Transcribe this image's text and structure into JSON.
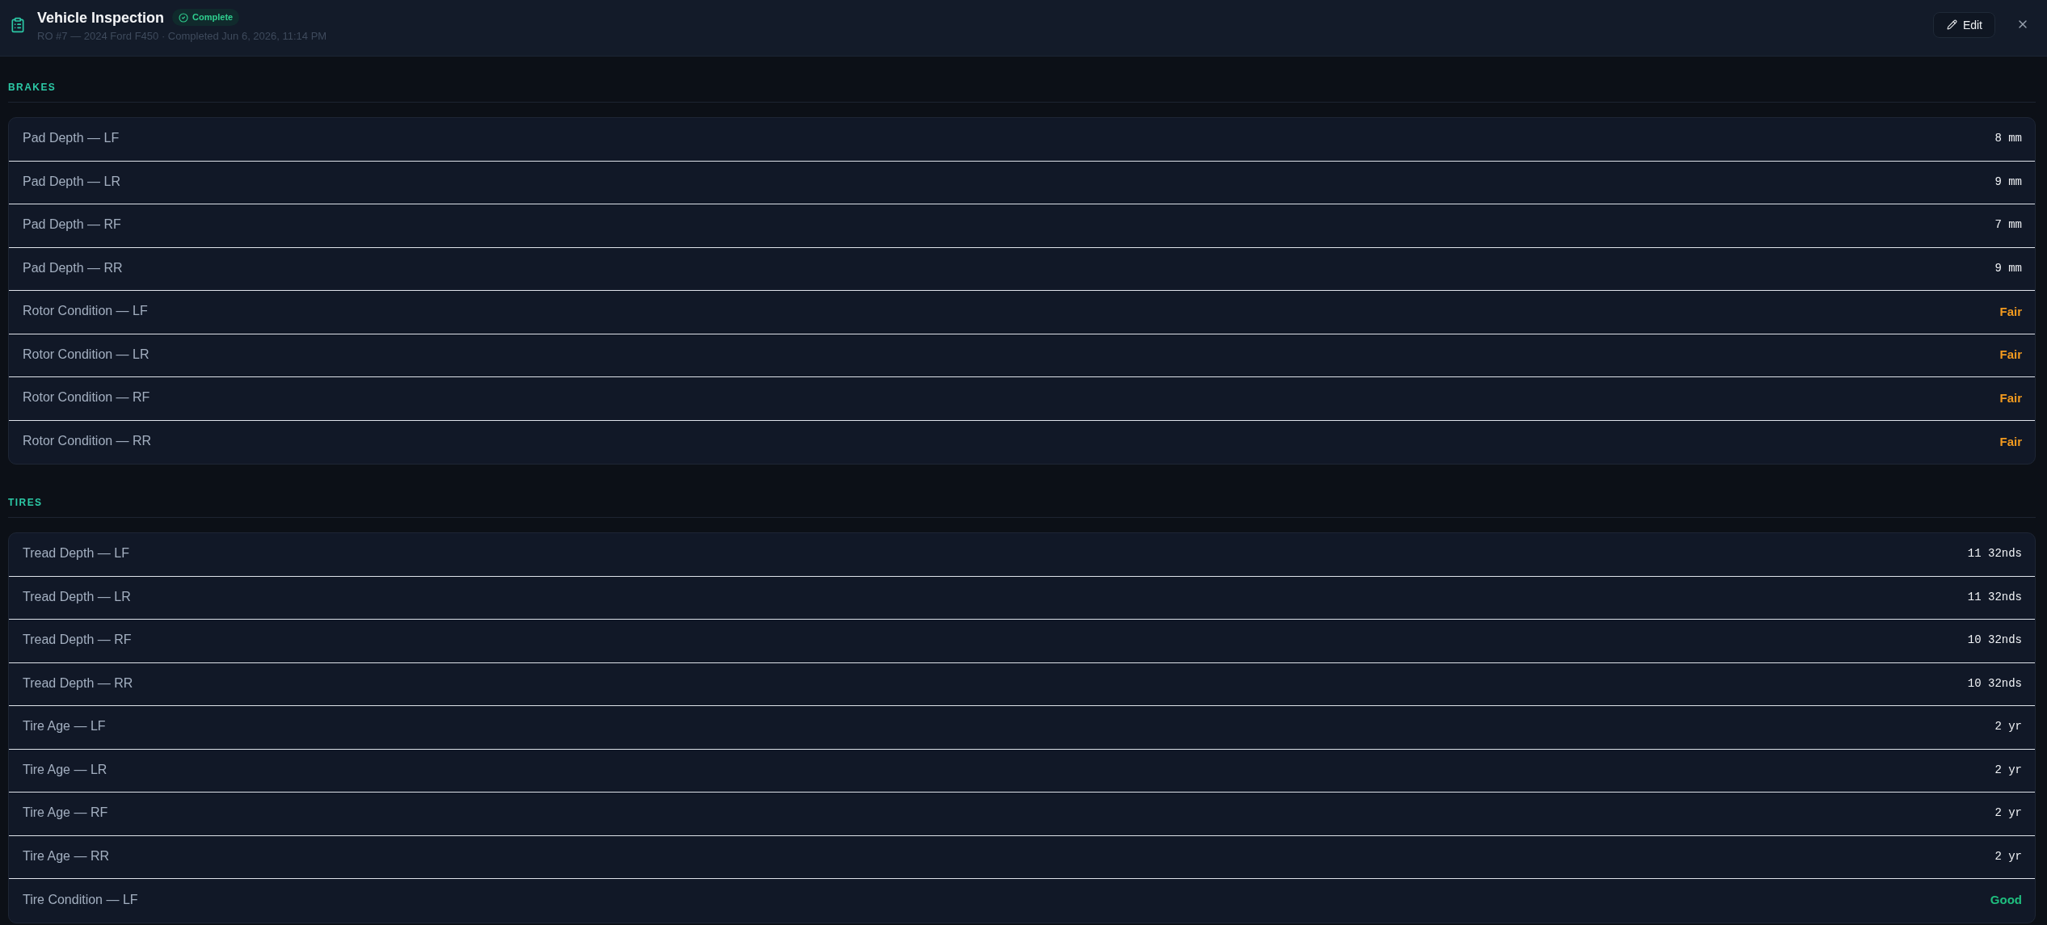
{
  "header": {
    "title": "Vehicle Inspection",
    "status": {
      "label": "Complete"
    },
    "subtitle": "RO #7 — 2024 Ford F450 · Completed Jun 6, 2026, 11:14 PM",
    "edit_button": "Edit"
  },
  "sections": [
    {
      "title": "BRAKES",
      "items": [
        {
          "label": "Pad Depth — LF",
          "kind": "measure",
          "value": "8 mm"
        },
        {
          "label": "Pad Depth — LR",
          "kind": "measure",
          "value": "9 mm"
        },
        {
          "label": "Pad Depth — RF",
          "kind": "measure",
          "value": "7 mm"
        },
        {
          "label": "Pad Depth — RR",
          "kind": "measure",
          "value": "9 mm"
        },
        {
          "label": "Rotor Condition — LF",
          "kind": "rating",
          "value": "Fair",
          "color": "#f29a1f"
        },
        {
          "label": "Rotor Condition — LR",
          "kind": "rating",
          "value": "Fair",
          "color": "#f29a1f"
        },
        {
          "label": "Rotor Condition — RF",
          "kind": "rating",
          "value": "Fair",
          "color": "#f29a1f"
        },
        {
          "label": "Rotor Condition — RR",
          "kind": "rating",
          "value": "Fair",
          "color": "#f29a1f"
        }
      ]
    },
    {
      "title": "TIRES",
      "items": [
        {
          "label": "Tread Depth — LF",
          "kind": "measure",
          "value": "11 32nds"
        },
        {
          "label": "Tread Depth — LR",
          "kind": "measure",
          "value": "11 32nds"
        },
        {
          "label": "Tread Depth — RF",
          "kind": "measure",
          "value": "10 32nds"
        },
        {
          "label": "Tread Depth — RR",
          "kind": "measure",
          "value": "10 32nds"
        },
        {
          "label": "Tire Age — LF",
          "kind": "measure",
          "value": "2 yr"
        },
        {
          "label": "Tire Age — LR",
          "kind": "measure",
          "value": "2 yr"
        },
        {
          "label": "Tire Age — RF",
          "kind": "measure",
          "value": "2 yr"
        },
        {
          "label": "Tire Age — RR",
          "kind": "measure",
          "value": "2 yr"
        },
        {
          "label": "Tire Condition — LF",
          "kind": "rating",
          "value": "Good",
          "color": "#1fbf7f"
        }
      ]
    }
  ]
}
